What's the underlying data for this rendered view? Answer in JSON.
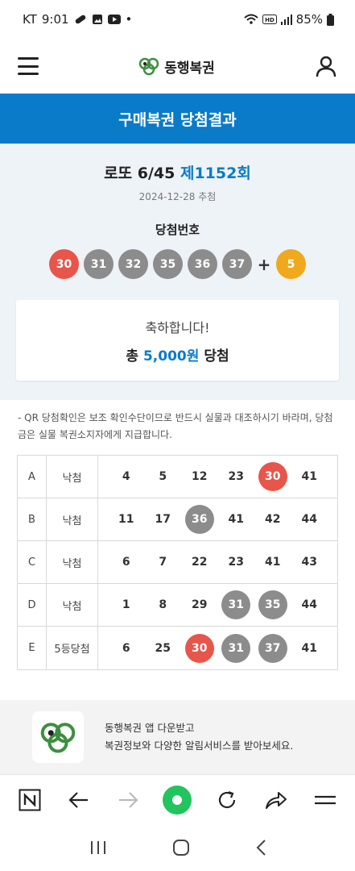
{
  "status_bar": {
    "carrier": "KT",
    "time": "9:01",
    "battery": "85%",
    "dot": "•"
  },
  "header": {
    "brand": "동행복권"
  },
  "page_title": "구매복권 당첨결과",
  "draw": {
    "game": "로또 6/45",
    "round": "제1152회",
    "date": "2024-12-28 추첨",
    "winning_label": "당첨번호",
    "numbers": [
      "30",
      "31",
      "32",
      "35",
      "36",
      "37"
    ],
    "plus": "+",
    "bonus": "5"
  },
  "result": {
    "message": "축하합니다!",
    "total_prefix": "총",
    "amount": "5,000원",
    "total_suffix": "당첨"
  },
  "notice": "- QR 당첨확인은 보조 확인수단이므로 반드시 실물과 대조하시기 바라며, 당첨금은 실물 복권소지자에게 지급합니다.",
  "tickets": [
    {
      "game": "A",
      "result": "낙첨",
      "numbers": [
        "4",
        "5",
        "12",
        "23",
        "30",
        "41"
      ],
      "hits": [
        "",
        "",
        "",
        "",
        "red",
        ""
      ]
    },
    {
      "game": "B",
      "result": "낙첨",
      "numbers": [
        "11",
        "17",
        "36",
        "41",
        "42",
        "44"
      ],
      "hits": [
        "",
        "",
        "gray",
        "",
        "",
        ""
      ]
    },
    {
      "game": "C",
      "result": "낙첨",
      "numbers": [
        "6",
        "7",
        "22",
        "23",
        "41",
        "43"
      ],
      "hits": [
        "",
        "",
        "",
        "",
        "",
        ""
      ]
    },
    {
      "game": "D",
      "result": "낙첨",
      "numbers": [
        "1",
        "8",
        "29",
        "31",
        "35",
        "44"
      ],
      "hits": [
        "",
        "",
        "",
        "gray",
        "gray",
        ""
      ]
    },
    {
      "game": "E",
      "result": "5등당첨",
      "numbers": [
        "6",
        "25",
        "30",
        "31",
        "37",
        "41"
      ],
      "hits": [
        "",
        "",
        "red",
        "gray",
        "gray",
        ""
      ]
    }
  ],
  "promo": {
    "line1": "동행복권 앱 다운받고",
    "line2": "복권정보와 다양한 알림서비스를 받아보세요."
  },
  "colors": {
    "brand_blue": "#0a7bc9",
    "ball_red": "#e8554a",
    "ball_gray": "#8c8c8c",
    "ball_yellow": "#f0a81c",
    "logo_green": "#3e8e41",
    "browser_green": "#21c45d"
  },
  "icons": {
    "menu": "hamburger-icon",
    "user": "user-icon",
    "n_menu": "naver-n-icon",
    "back": "arrow-left-icon",
    "forward": "arrow-right-icon",
    "home": "green-dot-icon",
    "reload": "reload-icon",
    "share": "share-icon",
    "more": "menu-lines-icon"
  }
}
